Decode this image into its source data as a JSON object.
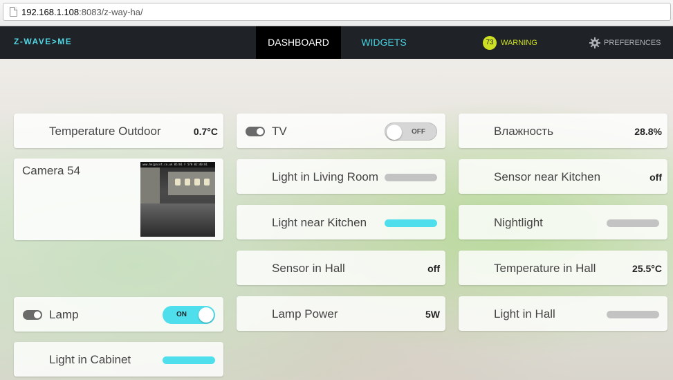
{
  "browser": {
    "url_host": "192.168.1.108",
    "url_rest": ":8083/z-way-ha/"
  },
  "nav": {
    "logo": "Z-WAVE>ME",
    "tabs": [
      {
        "label": "DASHBOARD",
        "active": true
      },
      {
        "label": "WIDGETS",
        "active": false
      }
    ],
    "warning_count": "73",
    "warning_label": "WARNING",
    "preferences_label": "PREFERENCES"
  },
  "colors": {
    "accent": "#4fdfec",
    "nav_bg": "#1f2226",
    "warning": "#cde024"
  },
  "widgets": {
    "col1": {
      "temp_outdoor": {
        "label": "Temperature Outdoor",
        "value": "0.7°C"
      },
      "camera": {
        "label": "Camera 54",
        "caption": "www.hejpaint.co.uk 05/01 F 578 02:40:01"
      },
      "lamp": {
        "label": "Lamp",
        "switch": "ON",
        "state": "on"
      },
      "light_cabinet": {
        "label": "Light in Cabinet",
        "level": 1.0
      }
    },
    "col2": {
      "tv": {
        "label": "TV",
        "switch": "OFF",
        "state": "off"
      },
      "light_living": {
        "label": "Light in Living Room",
        "level": 0.0
      },
      "light_kitchen": {
        "label": "Light near Kitchen",
        "level": 1.0
      },
      "sensor_hall": {
        "label": "Sensor in Hall",
        "value": "off"
      },
      "lamp_power": {
        "label": "Lamp Power",
        "value": "5W"
      }
    },
    "col3": {
      "humidity": {
        "label": "Влажность",
        "value": "28.8%"
      },
      "sensor_kitchen": {
        "label": "Sensor near Kitchen",
        "value": "off"
      },
      "nightlight": {
        "label": "Nightlight",
        "level": 0.0
      },
      "temp_hall": {
        "label": "Temperature in Hall",
        "value": "25.5°C"
      },
      "light_hall": {
        "label": "Light in Hall",
        "level": 0.0
      }
    }
  }
}
